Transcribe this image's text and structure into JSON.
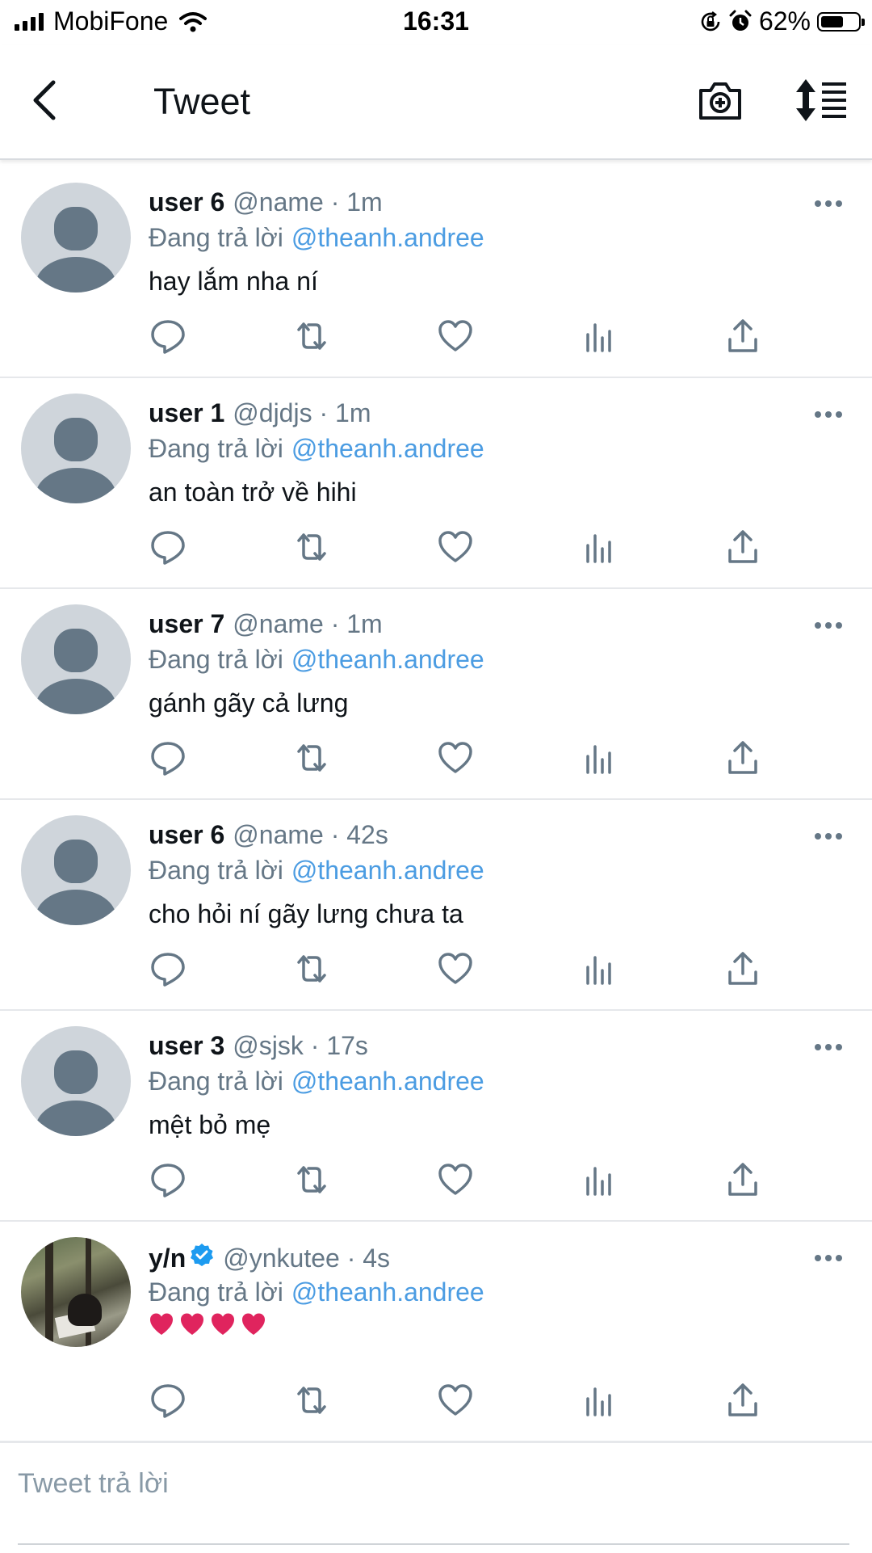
{
  "status_bar": {
    "carrier": "MobiFone",
    "time": "16:31",
    "battery_percent": "62%",
    "battery_level": 0.62,
    "icons": [
      "signal-icon",
      "wifi-icon",
      "orientation-lock-icon",
      "alarm-icon",
      "battery-icon"
    ]
  },
  "header": {
    "title": "Tweet",
    "icons": [
      "back-arrow-icon",
      "camera-add-icon",
      "sort-icon"
    ]
  },
  "tweets": [
    {
      "name": "user 6",
      "handle": "@name · 1m",
      "reply_prefix": "Đang trả lời",
      "reply_to": "@theanh.andree",
      "text": "hay lắm nha ní"
    },
    {
      "name": "user 1",
      "handle": "@djdjs · 1m",
      "reply_prefix": "Đang trả lời",
      "reply_to": "@theanh.andree",
      "text": "an toàn trở về hihi"
    },
    {
      "name": "user 7",
      "handle": "@name · 1m",
      "reply_prefix": "Đang trả lời",
      "reply_to": "@theanh.andree",
      "text": "gánh gãy cả lưng"
    },
    {
      "name": "user 6",
      "handle": "@name · 42s",
      "reply_prefix": "Đang trả lời",
      "reply_to": "@theanh.andree",
      "text": "cho hỏi ní gãy lưng chưa ta"
    },
    {
      "name": "user 3",
      "handle": "@sjsk · 17s",
      "reply_prefix": "Đang trả lời",
      "reply_to": "@theanh.andree",
      "text": "mệt bỏ mẹ"
    },
    {
      "name": "y/n",
      "handle": "@ynkutee · 4s",
      "reply_prefix": "Đang trả lời",
      "reply_to": "@theanh.andree",
      "text": "",
      "verified": true,
      "hearts": 4
    }
  ],
  "tweet_actions": [
    "reply-icon",
    "retweet-icon",
    "like-icon",
    "analytics-icon",
    "share-icon"
  ],
  "colors": {
    "link": "#4b9ce2",
    "secondary_text": "#657786",
    "verified": "#1d9bf0",
    "heart": "#e0245e",
    "avatar_placeholder": "#cfd5db"
  },
  "reply_box": {
    "placeholder": "Tweet trả lời"
  }
}
